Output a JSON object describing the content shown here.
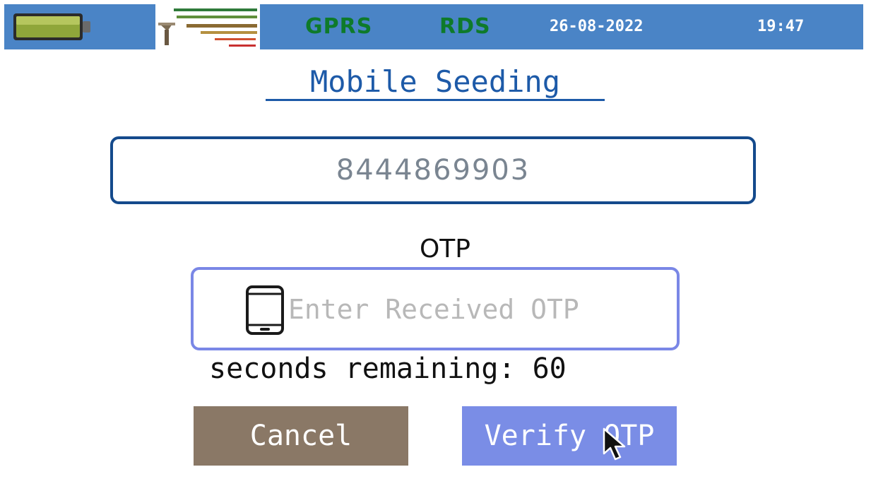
{
  "status_bar": {
    "network": "GPRS",
    "mode": "RDS",
    "date": "26-08-2022",
    "time": "19:47",
    "battery_icon": "battery-icon",
    "logo_icon": "signal-logo-icon"
  },
  "page": {
    "title": "Mobile Seeding"
  },
  "mobile_field": {
    "value": "8444869903"
  },
  "otp": {
    "label": "OTP",
    "placeholder": "Enter Received OTP",
    "icon": "phone-icon"
  },
  "countdown": {
    "label": "seconds remaining:",
    "value": "60"
  },
  "buttons": {
    "cancel_label": "Cancel",
    "verify_label": "Verify OTP"
  },
  "colors": {
    "status_bar": "#4a84c6",
    "title": "#1d5aa8",
    "cancel": "#8a7866",
    "verify": "#7a8de6",
    "status_green": "#0e7a2a"
  }
}
